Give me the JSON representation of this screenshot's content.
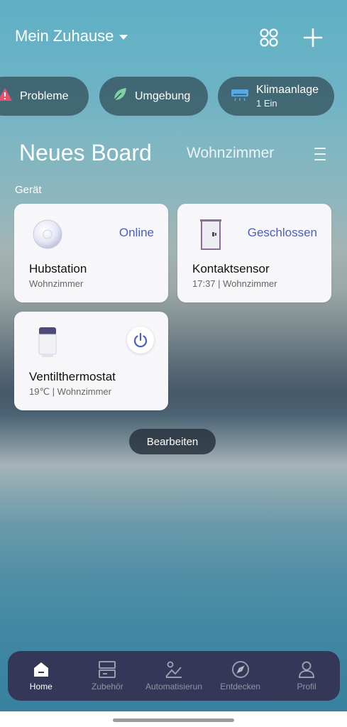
{
  "header": {
    "title": "Mein Zuhause",
    "icons": [
      "grid-icon",
      "plus-icon"
    ]
  },
  "chips": [
    {
      "label": "Probleme",
      "icon": "warning-icon",
      "color": "#e8536b"
    },
    {
      "label": "Umgebung",
      "icon": "leaf-icon",
      "color": "#7dd3a0"
    },
    {
      "label": "Klimaanlage",
      "sub": "1 Ein",
      "icon": "air-conditioner-icon",
      "color": "#5aa8e0"
    }
  ],
  "board": {
    "title": "Neues Board",
    "room": "Wohnzimmer"
  },
  "section_label": "Gerät",
  "devices": [
    {
      "name": "Hubstation",
      "status": "Online",
      "meta": "Wohnzimmer",
      "icon": "hub-icon"
    },
    {
      "name": "Kontaktsensor",
      "status": "Geschlossen",
      "meta": "17:37 | Wohnzimmer",
      "icon": "door-sensor-icon"
    },
    {
      "name": "Ventilthermostat",
      "meta": "19℃ | Wohnzimmer",
      "icon": "thermostat-icon",
      "action_icon": "power-icon"
    }
  ],
  "edit_label": "Bearbeiten",
  "nav": [
    {
      "label": "Home",
      "icon": "home-icon",
      "active": true
    },
    {
      "label": "Zubehör",
      "icon": "accessories-icon"
    },
    {
      "label": "Automatisierun",
      "icon": "automation-icon"
    },
    {
      "label": "Entdecken",
      "icon": "compass-icon"
    },
    {
      "label": "Profil",
      "icon": "profile-icon"
    }
  ],
  "colors": {
    "accent": "#4a5fc1",
    "nav_bg": "#343252",
    "chip_bg": "#34525e"
  }
}
